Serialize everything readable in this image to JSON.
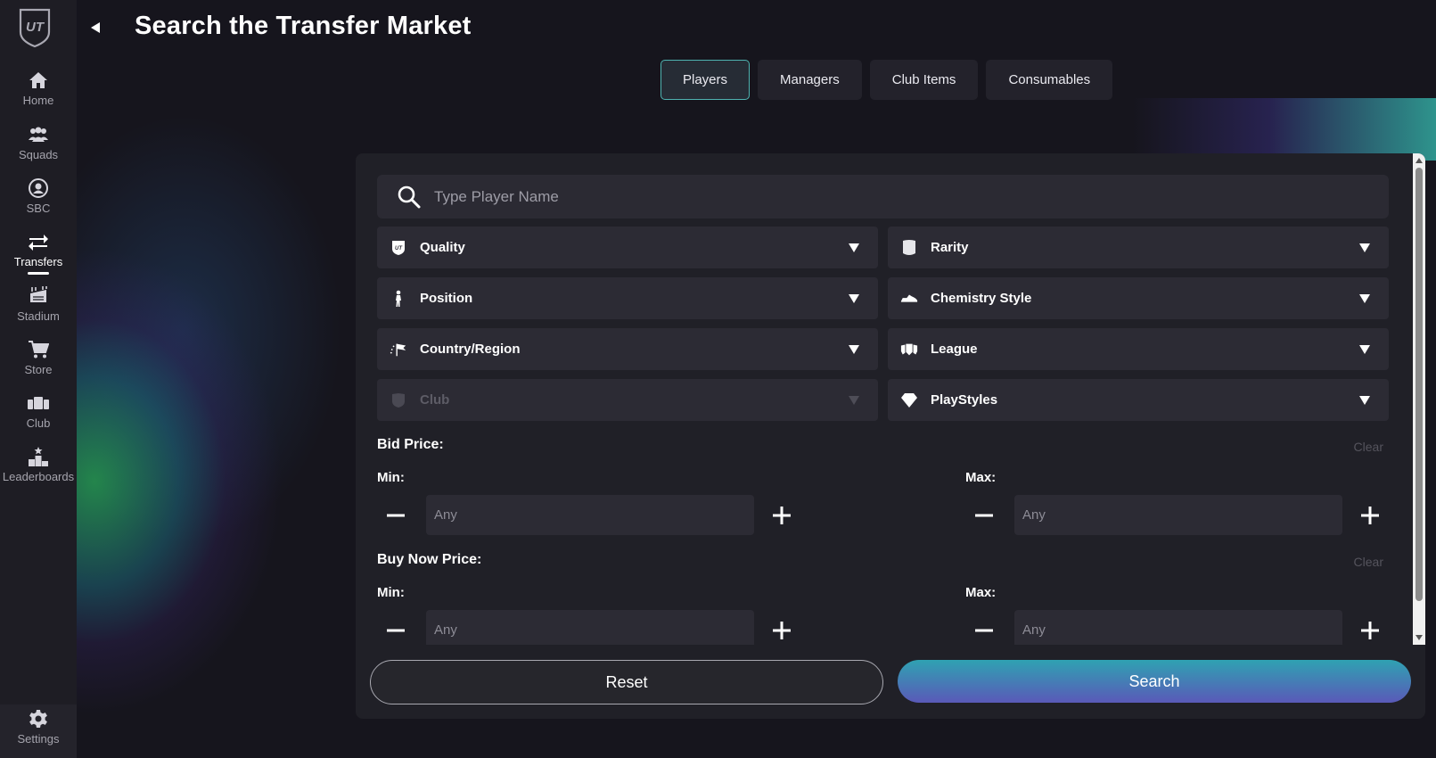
{
  "sidebar": {
    "logo_text": "UT",
    "items": [
      {
        "label": "Home",
        "icon": "home-icon"
      },
      {
        "label": "Squads",
        "icon": "squads-icon"
      },
      {
        "label": "SBC",
        "icon": "sbc-icon"
      },
      {
        "label": "Transfers",
        "icon": "transfers-icon",
        "active": true
      },
      {
        "label": "Stadium",
        "icon": "stadium-icon"
      },
      {
        "label": "Store",
        "icon": "store-icon"
      },
      {
        "label": "Club",
        "icon": "club-icon"
      },
      {
        "label": "Leaderboards",
        "icon": "leaderboards-icon"
      }
    ],
    "settings_label": "Settings"
  },
  "header": {
    "title": "Search the Transfer Market"
  },
  "tabs": [
    {
      "label": "Players",
      "active": true
    },
    {
      "label": "Managers"
    },
    {
      "label": "Club Items"
    },
    {
      "label": "Consumables"
    }
  ],
  "search": {
    "placeholder": "Type Player Name",
    "value": ""
  },
  "filters": {
    "quality": "Quality",
    "rarity": "Rarity",
    "position": "Position",
    "chemistry_style": "Chemistry Style",
    "country_region": "Country/Region",
    "league": "League",
    "club": "Club",
    "playstyles": "PlayStyles"
  },
  "bid_price": {
    "title": "Bid Price:",
    "clear_label": "Clear",
    "min_label": "Min:",
    "max_label": "Max:",
    "min_placeholder": "Any",
    "max_placeholder": "Any"
  },
  "buy_now_price": {
    "title": "Buy Now Price:",
    "clear_label": "Clear",
    "min_label": "Min:",
    "max_label": "Max:",
    "min_placeholder": "Any",
    "max_placeholder": "Any"
  },
  "actions": {
    "reset_label": "Reset",
    "search_label": "Search"
  },
  "colors": {
    "accent_tab_border": "#4fb3b0",
    "search_gradient_top": "#2fa2b2",
    "search_gradient_bottom": "#5a59b8",
    "background": "#16151d"
  }
}
